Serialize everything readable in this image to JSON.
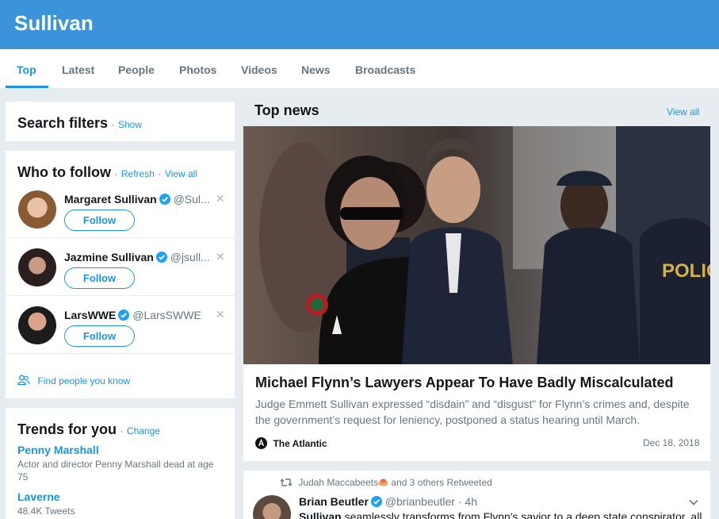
{
  "header": {
    "query": "Sullivan"
  },
  "tabs": [
    "Top",
    "Latest",
    "People",
    "Photos",
    "Videos",
    "News",
    "Broadcasts"
  ],
  "search_filters": {
    "title": "Search filters",
    "sep": "·",
    "link": "Show"
  },
  "who_to_follow": {
    "title": "Who to follow",
    "sep": "·",
    "refresh": "Refresh",
    "view_all": "View all",
    "users": [
      {
        "name": "Margaret Sullivan",
        "handle": "@Sul...",
        "follow": "Follow"
      },
      {
        "name": "Jazmine Sullivan",
        "handle": "@jsull...",
        "follow": "Follow"
      },
      {
        "name": "LarsWWE",
        "handle": "@LarsSWWE",
        "follow": "Follow"
      }
    ],
    "find_people": "Find people you know"
  },
  "trends": {
    "title": "Trends for you",
    "sep": "·",
    "change": "Change",
    "items": [
      {
        "name": "Penny Marshall",
        "desc": "Actor and director Penny Marshall dead at age 75"
      },
      {
        "name": "Laverne",
        "desc": "48.4K Tweets"
      }
    ]
  },
  "top_news": {
    "title": "Top news",
    "view_all": "View all",
    "headline": "Michael Flynn’s Lawyers Appear To Have Badly Miscalculated",
    "summary": "Judge Emmett Sullivan expressed “disdain” and “disgust” for Flynn’s crimes and, despite the government’s request for leniency, postponed a status hearing until March.",
    "source": "The Atlantic",
    "date": "Dec 18, 2018",
    "image_badge": "POLICE"
  },
  "tweet": {
    "retweet_context": "Judah Maccabeets",
    "retweet_rest": "and 3 others Retweeted",
    "author": "Brian Beutler",
    "handle": "@brianbeutler",
    "sep": "·",
    "time": "4h",
    "text_bold": "Sullivan",
    "text_rest": "seamlessly transforms from Flynn's savior to a deep state conspirator, all"
  },
  "colors": {
    "brand_blue": "#3b94d9",
    "link_blue": "#1b95e0",
    "background": "#e6ecf0"
  },
  "icons": [
    "verified-icon",
    "close-icon",
    "people-icon",
    "retweet-icon",
    "chevron-down-icon",
    "atlantic-logo-icon"
  ]
}
